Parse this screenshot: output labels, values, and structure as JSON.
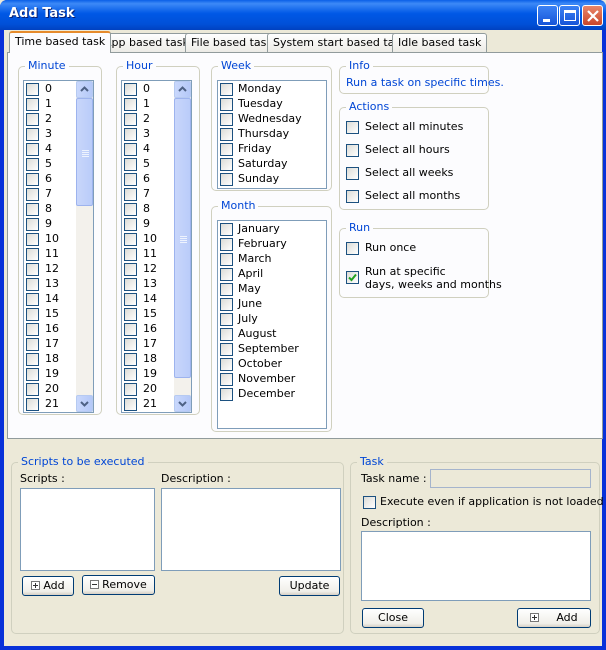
{
  "window": {
    "title": "Add Task"
  },
  "tabs": [
    "Time based task",
    "App based task",
    "File based task",
    "System start based task",
    "Idle based task"
  ],
  "minute": {
    "label": "Minute",
    "items": [
      "0",
      "1",
      "2",
      "3",
      "4",
      "5",
      "6",
      "7",
      "8",
      "9",
      "10",
      "11",
      "12",
      "13",
      "14",
      "15",
      "16",
      "17",
      "18",
      "19",
      "20",
      "21"
    ]
  },
  "hour": {
    "label": "Hour",
    "items": [
      "0",
      "1",
      "2",
      "3",
      "4",
      "5",
      "6",
      "7",
      "8",
      "9",
      "10",
      "11",
      "12",
      "13",
      "14",
      "15",
      "16",
      "17",
      "18",
      "19",
      "20",
      "21"
    ]
  },
  "week": {
    "label": "Week",
    "items": [
      "Monday",
      "Tuesday",
      "Wednesday",
      "Thursday",
      "Friday",
      "Saturday",
      "Sunday"
    ]
  },
  "month": {
    "label": "Month",
    "items": [
      "January",
      "February",
      "March",
      "April",
      "May",
      "June",
      "July",
      "August",
      "September",
      "October",
      "November",
      "December"
    ]
  },
  "info": {
    "label": "Info",
    "text": "Run a task on specific times."
  },
  "actions": {
    "label": "Actions",
    "items": [
      "Select all minutes",
      "Select all hours",
      "Select all weeks",
      "Select all months"
    ]
  },
  "run": {
    "label": "Run",
    "once": "Run once",
    "specific_line1": "Run at specific",
    "specific_line2": "days, weeks and months",
    "specific_checked": true
  },
  "scripts": {
    "group_label": "Scripts to be executed",
    "scripts_label": "Scripts :",
    "description_label": "Description :",
    "add": "Add",
    "remove": "Remove",
    "update": "Update"
  },
  "task": {
    "group_label": "Task",
    "name_label": "Task name :",
    "name_value": "",
    "execute_label": "Execute even if application is not loaded",
    "description_label": "Description :",
    "close": "Close",
    "add": "Add"
  }
}
